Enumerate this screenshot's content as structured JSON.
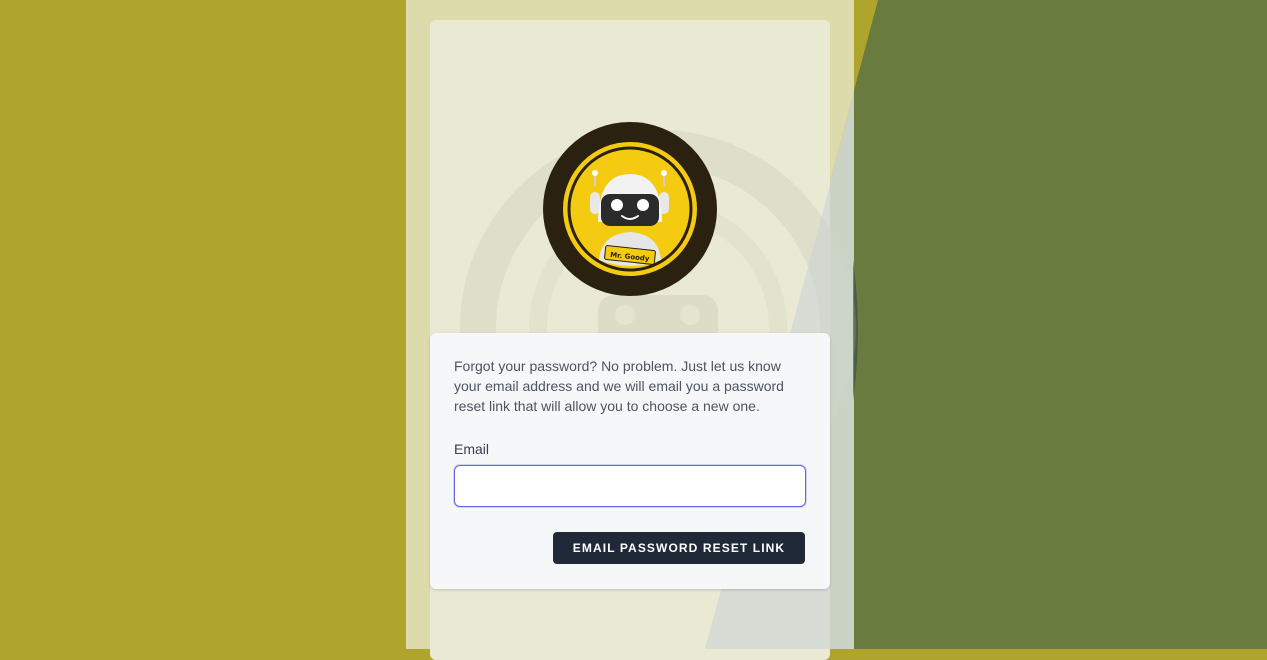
{
  "colors": {
    "background_left": "#afa52c",
    "background_right": "#6a7b40",
    "panel": "#e9e9d4",
    "card": "#f6f7f9",
    "button": "#1f2937",
    "input_focus": "#6366f1",
    "logo_yellow": "#f4cb10",
    "logo_dark": "#2a2110"
  },
  "logo": {
    "badge_text": "Mr. Goody",
    "icon": "robot-mascot-icon"
  },
  "form": {
    "intro_text": "Forgot your password? No problem. Just let us know your email address and we will email you a password reset link that will allow you to choose a new one.",
    "email_label": "Email",
    "email_value": "",
    "email_placeholder": "",
    "submit_label": "EMAIL PASSWORD RESET LINK"
  }
}
